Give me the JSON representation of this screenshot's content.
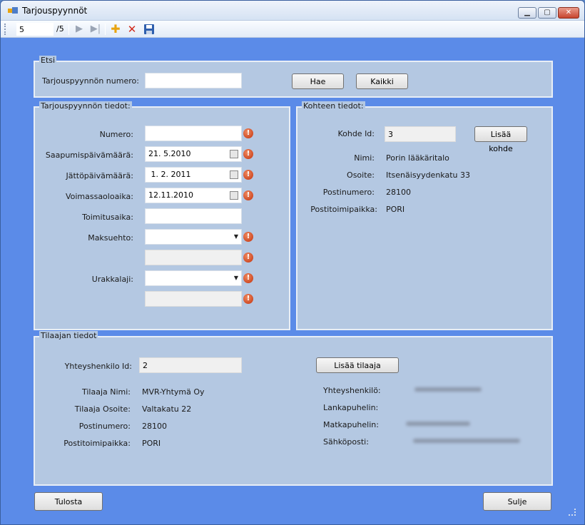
{
  "window": {
    "title": "Tarjouspyynnöt"
  },
  "toolbar": {
    "position": "5",
    "total": "/5"
  },
  "search": {
    "title": "Etsi",
    "number_label": "Tarjouspyynnön numero:",
    "number_value": "",
    "search_button": "Hae",
    "all_button": "Kaikki"
  },
  "details": {
    "title": "Tarjouspyynnön tiedot:",
    "numero_label": "Numero:",
    "numero_value": "",
    "arrival_label": "Saapumispäivämäärä:",
    "arrival_value": "21. 5.2010",
    "deadline_label": "Jättöpäivämäärä:",
    "deadline_value": " 1. 2. 2011",
    "validity_label": "Voimassaoloaika:",
    "validity_value": "12.11.2010",
    "delivery_label": "Toimitusaika:",
    "delivery_value": "",
    "payment_label": "Maksuehto:",
    "payment_value": "",
    "payment_extra_value": "",
    "contract_label": "Urakkalaji:",
    "contract_value": "",
    "contract_extra_value": ""
  },
  "target": {
    "title": "Kohteen tiedot:",
    "id_label": "Kohde Id:",
    "id_value": "3",
    "add_button": "Lisää kohde",
    "name_label": "Nimi:",
    "name_value": "Porin lääkäritalo",
    "address_label": "Osoite:",
    "address_value": "Itsenäisyydenkatu 33",
    "postcode_label": "Postinumero:",
    "postcode_value": "28100",
    "city_label": "Postitoimipaikka:",
    "city_value": "PORI"
  },
  "client": {
    "title": "Tilaajan tiedot",
    "contact_id_label": "Yhteyshenkilo Id:",
    "contact_id_value": "2",
    "add_button": "Lisää tilaaja",
    "name_label": "Tilaaja Nimi:",
    "name_value": "MVR-Yhtymä Oy",
    "address_label": "Tilaaja Osoite:",
    "address_value": "Valtakatu 22",
    "postcode_label": "Postinumero:",
    "postcode_value": "28100",
    "city_label": "Postitoimipaikka:",
    "city_value": "PORI",
    "contact_label": "Yhteyshenkilö:",
    "landline_label": "Lankapuhelin:",
    "mobile_label": "Matkapuhelin:",
    "email_label": "Sähköposti:"
  },
  "footer": {
    "print_button": "Tulosta",
    "close_button": "Sulje"
  },
  "colors": {
    "background": "#5b8be8",
    "panel": "#b4c8e2",
    "error": "#c2320e"
  }
}
